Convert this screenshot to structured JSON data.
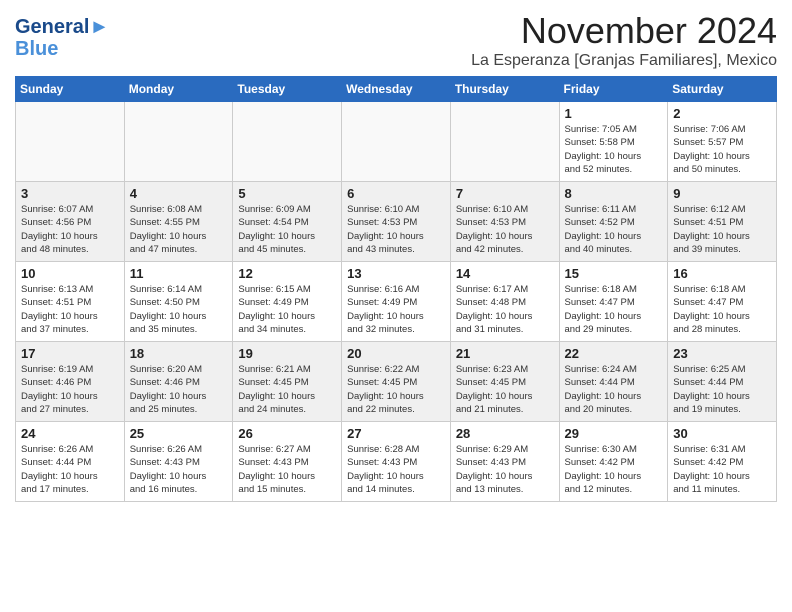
{
  "header": {
    "logo_line1": "General",
    "logo_line2": "Blue",
    "month_title": "November 2024",
    "location": "La Esperanza [Granjas Familiares], Mexico"
  },
  "calendar": {
    "days_of_week": [
      "Sunday",
      "Monday",
      "Tuesday",
      "Wednesday",
      "Thursday",
      "Friday",
      "Saturday"
    ],
    "weeks": [
      [
        {
          "day": "",
          "info": "",
          "empty": true
        },
        {
          "day": "",
          "info": "",
          "empty": true
        },
        {
          "day": "",
          "info": "",
          "empty": true
        },
        {
          "day": "",
          "info": "",
          "empty": true
        },
        {
          "day": "",
          "info": "",
          "empty": true
        },
        {
          "day": "1",
          "info": "Sunrise: 7:05 AM\nSunset: 5:58 PM\nDaylight: 10 hours\nand 52 minutes."
        },
        {
          "day": "2",
          "info": "Sunrise: 7:06 AM\nSunset: 5:57 PM\nDaylight: 10 hours\nand 50 minutes."
        }
      ],
      [
        {
          "day": "3",
          "info": "Sunrise: 6:07 AM\nSunset: 4:56 PM\nDaylight: 10 hours\nand 48 minutes."
        },
        {
          "day": "4",
          "info": "Sunrise: 6:08 AM\nSunset: 4:55 PM\nDaylight: 10 hours\nand 47 minutes."
        },
        {
          "day": "5",
          "info": "Sunrise: 6:09 AM\nSunset: 4:54 PM\nDaylight: 10 hours\nand 45 minutes."
        },
        {
          "day": "6",
          "info": "Sunrise: 6:10 AM\nSunset: 4:53 PM\nDaylight: 10 hours\nand 43 minutes."
        },
        {
          "day": "7",
          "info": "Sunrise: 6:10 AM\nSunset: 4:53 PM\nDaylight: 10 hours\nand 42 minutes."
        },
        {
          "day": "8",
          "info": "Sunrise: 6:11 AM\nSunset: 4:52 PM\nDaylight: 10 hours\nand 40 minutes."
        },
        {
          "day": "9",
          "info": "Sunrise: 6:12 AM\nSunset: 4:51 PM\nDaylight: 10 hours\nand 39 minutes."
        }
      ],
      [
        {
          "day": "10",
          "info": "Sunrise: 6:13 AM\nSunset: 4:51 PM\nDaylight: 10 hours\nand 37 minutes."
        },
        {
          "day": "11",
          "info": "Sunrise: 6:14 AM\nSunset: 4:50 PM\nDaylight: 10 hours\nand 35 minutes."
        },
        {
          "day": "12",
          "info": "Sunrise: 6:15 AM\nSunset: 4:49 PM\nDaylight: 10 hours\nand 34 minutes."
        },
        {
          "day": "13",
          "info": "Sunrise: 6:16 AM\nSunset: 4:49 PM\nDaylight: 10 hours\nand 32 minutes."
        },
        {
          "day": "14",
          "info": "Sunrise: 6:17 AM\nSunset: 4:48 PM\nDaylight: 10 hours\nand 31 minutes."
        },
        {
          "day": "15",
          "info": "Sunrise: 6:18 AM\nSunset: 4:47 PM\nDaylight: 10 hours\nand 29 minutes."
        },
        {
          "day": "16",
          "info": "Sunrise: 6:18 AM\nSunset: 4:47 PM\nDaylight: 10 hours\nand 28 minutes."
        }
      ],
      [
        {
          "day": "17",
          "info": "Sunrise: 6:19 AM\nSunset: 4:46 PM\nDaylight: 10 hours\nand 27 minutes."
        },
        {
          "day": "18",
          "info": "Sunrise: 6:20 AM\nSunset: 4:46 PM\nDaylight: 10 hours\nand 25 minutes."
        },
        {
          "day": "19",
          "info": "Sunrise: 6:21 AM\nSunset: 4:45 PM\nDaylight: 10 hours\nand 24 minutes."
        },
        {
          "day": "20",
          "info": "Sunrise: 6:22 AM\nSunset: 4:45 PM\nDaylight: 10 hours\nand 22 minutes."
        },
        {
          "day": "21",
          "info": "Sunrise: 6:23 AM\nSunset: 4:45 PM\nDaylight: 10 hours\nand 21 minutes."
        },
        {
          "day": "22",
          "info": "Sunrise: 6:24 AM\nSunset: 4:44 PM\nDaylight: 10 hours\nand 20 minutes."
        },
        {
          "day": "23",
          "info": "Sunrise: 6:25 AM\nSunset: 4:44 PM\nDaylight: 10 hours\nand 19 minutes."
        }
      ],
      [
        {
          "day": "24",
          "info": "Sunrise: 6:26 AM\nSunset: 4:44 PM\nDaylight: 10 hours\nand 17 minutes."
        },
        {
          "day": "25",
          "info": "Sunrise: 6:26 AM\nSunset: 4:43 PM\nDaylight: 10 hours\nand 16 minutes."
        },
        {
          "day": "26",
          "info": "Sunrise: 6:27 AM\nSunset: 4:43 PM\nDaylight: 10 hours\nand 15 minutes."
        },
        {
          "day": "27",
          "info": "Sunrise: 6:28 AM\nSunset: 4:43 PM\nDaylight: 10 hours\nand 14 minutes."
        },
        {
          "day": "28",
          "info": "Sunrise: 6:29 AM\nSunset: 4:43 PM\nDaylight: 10 hours\nand 13 minutes."
        },
        {
          "day": "29",
          "info": "Sunrise: 6:30 AM\nSunset: 4:42 PM\nDaylight: 10 hours\nand 12 minutes."
        },
        {
          "day": "30",
          "info": "Sunrise: 6:31 AM\nSunset: 4:42 PM\nDaylight: 10 hours\nand 11 minutes."
        }
      ]
    ]
  }
}
